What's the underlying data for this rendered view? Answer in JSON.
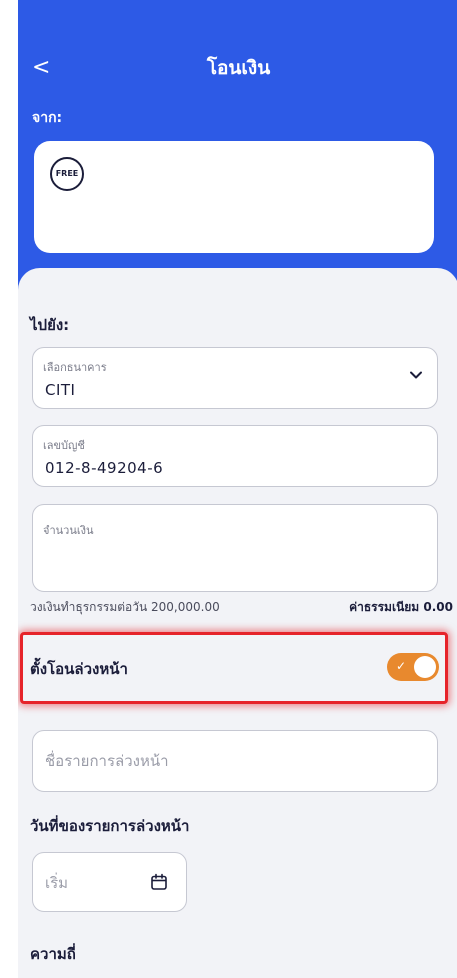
{
  "header": {
    "back_icon": "chevron-left-icon",
    "back_glyph": "<",
    "title": "โอนเงิน",
    "from_label": "จาก:",
    "free_badge": "FREE",
    "color": "#2d5ae6"
  },
  "to_section": {
    "label": "ไปยัง:",
    "bank_field": {
      "label": "เลือกธนาคาร",
      "value": "CITI",
      "icon": "chevron-down-icon"
    },
    "account_field": {
      "label": "เลขบัญชี",
      "value": "012-8-49204-6"
    },
    "amount_field": {
      "label": "จำนวนเงิน",
      "value": ""
    },
    "daily_limit": "วงเงินทำธุรกรรมต่อวัน 200,000.00",
    "fee": "ค่าธรรมเนียม 0.00"
  },
  "advance_transfer": {
    "label": "ตั้งโอนล่วงหน้า",
    "enabled": true,
    "toggle_color": "#e8892e",
    "highlight_color": "#e6232a"
  },
  "advance_details": {
    "name_placeholder": "ชื่อรายการล่วงหน้า",
    "date_section_label": "วันที่ของรายการล่วงหน้า",
    "start_placeholder": "เริ่ม",
    "calendar_icon": "calendar-icon",
    "frequency_label": "ความถี่"
  }
}
